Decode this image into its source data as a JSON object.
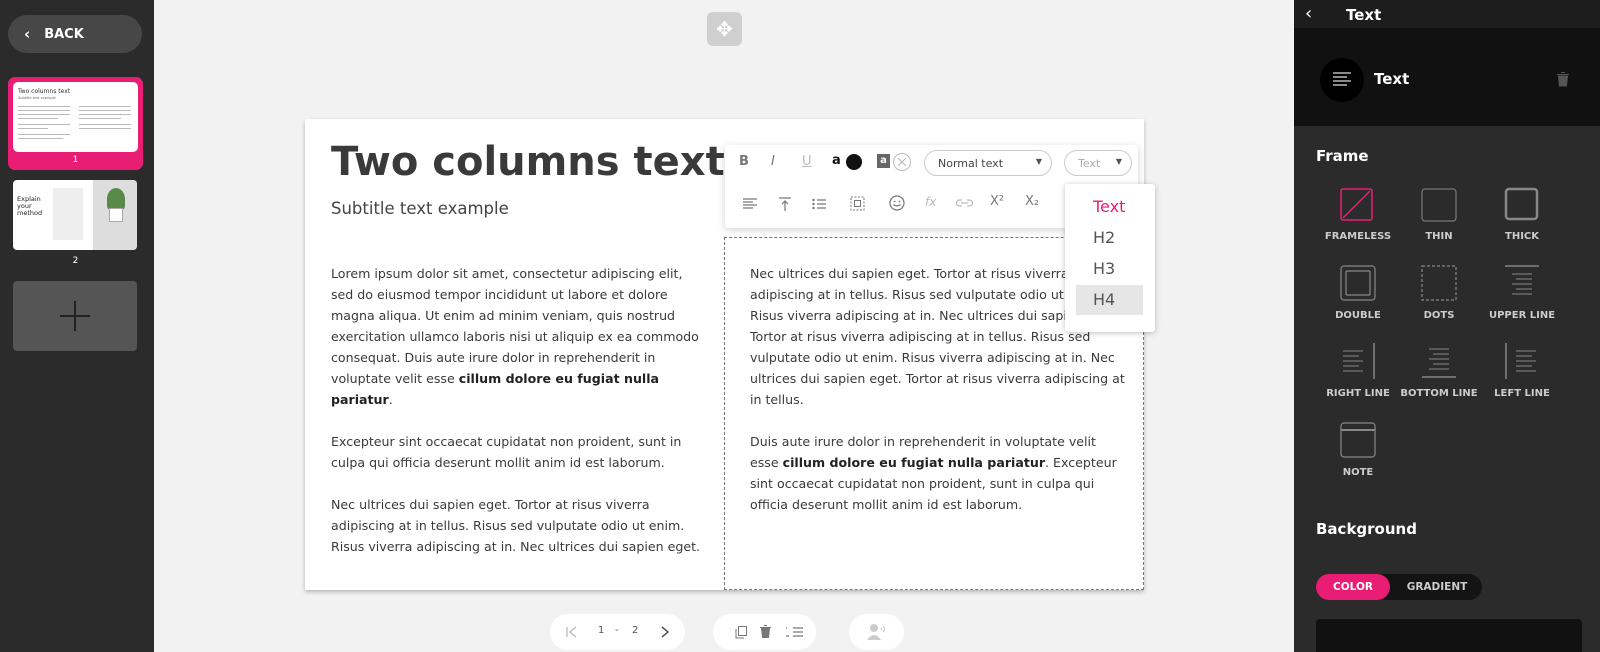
{
  "left": {
    "back_label": "BACK",
    "thumbnails": [
      {
        "number": "1",
        "title": "Two columns text",
        "subtitle": "Subtitle text example"
      },
      {
        "number": "2",
        "title": "Explain your method"
      }
    ]
  },
  "slide": {
    "title": "Two columns text",
    "subtitle": "Subtitle text example",
    "col1": {
      "p1": "Lorem ipsum dolor sit amet, consectetur adipiscing elit, sed do eiusmod tempor incididunt ut labore et dolore magna aliqua. Ut enim ad minim veniam, quis nostrud exercitation ullamco laboris nisi ut aliquip ex ea commodo consequat. Duis aute irure dolor in reprehenderit in voluptate velit esse ",
      "p1_bold": "cillum dolore eu fugiat nulla pariatur",
      "p1_end": ".",
      "p2": "Excepteur sint occaecat cupidatat non proident, sunt in culpa qui officia deserunt mollit anim id est laborum.",
      "p3": "Nec ultrices dui sapien eget. Tortor at risus viverra adipiscing at in tellus. Risus sed vulputate odio ut enim. Risus viverra adipiscing at in. Nec ultrices dui sapien eget."
    },
    "col2": {
      "p1": "Nec ultrices dui sapien eget. Tortor at risus viverra adipiscing at in tellus. Risus sed vulputate odio ut enim. Risus viverra adipiscing at in. Nec ultrices dui sapien eget. Tortor at risus viverra adipiscing at in tellus. Risus sed vulputate odio ut enim. Risus viverra adipiscing at in. Nec ultrices dui sapien eget. Tortor at risus viverra adipiscing at in tellus.",
      "p2": "Duis aute irure dolor in reprehenderit in voluptate velit esse ",
      "p2_bold": "cillum dolore eu fugiat nulla pariatur",
      "p2_end": ". Excepteur sint occaecat cupidatat non proident, sunt in culpa qui officia deserunt mollit anim id est laborum."
    }
  },
  "toolbar": {
    "bold": "B",
    "italic": "I",
    "underline": "U",
    "font_color": "a",
    "bg_color": "a",
    "style_select": "Normal text",
    "heading_select_placeholder": "Text",
    "superscript": "X²",
    "subscript": "X₂",
    "fx": "fx",
    "heading_options": [
      "Text",
      "H2",
      "H3",
      "H4"
    ]
  },
  "pagination": {
    "current": "1",
    "separator": "-",
    "total": "2"
  },
  "panel": {
    "header_title": "Text",
    "element_name": "Text",
    "frame_heading": "Frame",
    "frames": [
      "FRAMELESS",
      "THIN",
      "THICK",
      "DOUBLE",
      "DOTS",
      "UPPER LINE",
      "RIGHT LINE",
      "BOTTOM LINE",
      "LEFT LINE",
      "NOTE"
    ],
    "background_heading": "Background",
    "bg_tabs": [
      "COLOR",
      "GRADIENT"
    ]
  },
  "colors": {
    "accent": "#ea1d75",
    "sidebar": "#2b2b2b"
  }
}
